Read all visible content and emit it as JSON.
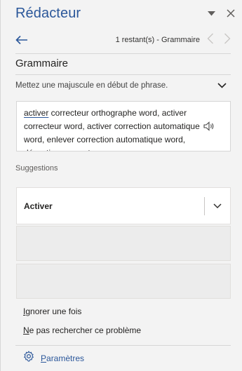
{
  "pane": {
    "title": "Rédacteur",
    "options_icon": "chevron-down-icon",
    "close_icon": "close-icon"
  },
  "nav": {
    "back_icon": "arrow-left-icon",
    "status": "1 restant(s) - Grammaire",
    "prev_icon": "chevron-left-icon",
    "next_icon": "chevron-right-icon"
  },
  "section": {
    "title": "Grammaire"
  },
  "issue": {
    "description": "Mettez une majuscule en début de phrase.",
    "expand_icon": "chevron-down-icon"
  },
  "context": {
    "flagged_word": "activer",
    "text": " correcteur orthographe word, activer correcteur word, activer correction automatique word, enlever correction automatique word, désactiver correcteur",
    "read_aloud_icon": "speaker-icon"
  },
  "suggestions": {
    "label": "Suggestions",
    "items": [
      {
        "label": "Activer",
        "more_icon": "chevron-down-icon"
      }
    ]
  },
  "actions": {
    "ignore_mnemonic": "I",
    "ignore_rest": "gnorer une fois",
    "dont_check_mnemonic": "N",
    "dont_check_rest": "e pas rechercher ce problème"
  },
  "footer": {
    "settings_icon": "gear-icon",
    "settings_mnemonic": "P",
    "settings_rest": "aramètres"
  },
  "colors": {
    "accent": "#2b579a",
    "pane_background": "#f3f3f3",
    "card_background": "#ffffff"
  }
}
